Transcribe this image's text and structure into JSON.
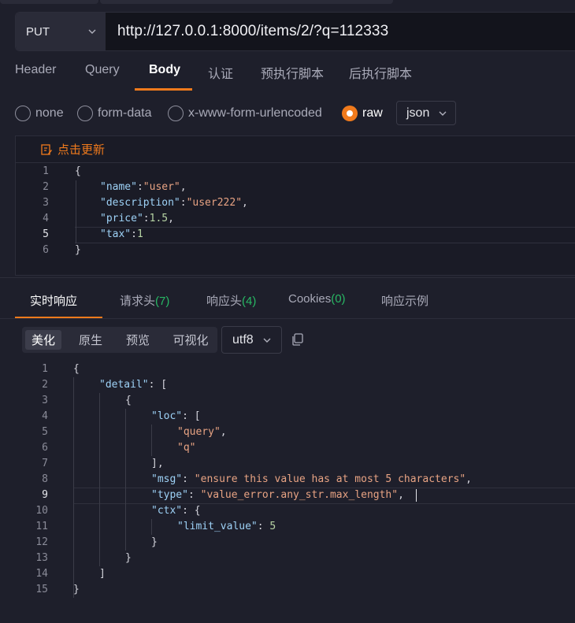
{
  "request": {
    "method": "PUT",
    "url": "http://127.0.0.1:8000/items/2/?q=112333",
    "tabs": [
      "Header",
      "Query",
      "Body",
      "认证",
      "预执行脚本",
      "后执行脚本"
    ],
    "active_tab": "Body",
    "body_types": [
      "none",
      "form-data",
      "x-www-form-urlencoded",
      "raw"
    ],
    "selected_body_type": "raw",
    "body_language": "json",
    "update_label": "点击更新"
  },
  "request_body_lines": [
    {
      "n": "1"
    },
    {
      "n": "2"
    },
    {
      "n": "3"
    },
    {
      "n": "4"
    },
    {
      "n": "5"
    },
    {
      "n": "6"
    }
  ],
  "request_body": {
    "l1": "{",
    "l2_key": "\"name\"",
    "l2_sep": ":",
    "l2_val": "\"user\"",
    "l2_end": ",",
    "l3_key": "\"description\"",
    "l3_sep": ":",
    "l3_val": "\"user222\"",
    "l3_end": ",",
    "l4_key": "\"price\"",
    "l4_sep": ":",
    "l4_val": "1.5",
    "l4_end": ",",
    "l5_key": "\"tax\"",
    "l5_sep": ":",
    "l5_val": "1",
    "l6": "}"
  },
  "response": {
    "tabs": [
      {
        "label": "实时响应",
        "count": ""
      },
      {
        "label": "请求头",
        "count": "(7)"
      },
      {
        "label": "响应头",
        "count": "(4)"
      },
      {
        "label": "Cookies",
        "count": "(0)"
      },
      {
        "label": "响应示例",
        "count": ""
      }
    ],
    "view_modes": [
      "美化",
      "原生",
      "预览",
      "可视化"
    ],
    "active_view": "美化",
    "encoding": "utf8"
  },
  "response_body": {
    "l1": "{",
    "l2_key": "\"detail\"",
    "l2_rest": ": [",
    "l3": "{",
    "l4_key": "\"loc\"",
    "l4_rest": ": [",
    "l5": "\"query\"",
    "l5_end": ",",
    "l6": "\"q\"",
    "l7": "],",
    "l8_key": "\"msg\"",
    "l8_sep": ": ",
    "l8_val": "\"ensure this value has at most 5 characters\"",
    "l8_end": ",",
    "l9_key": "\"type\"",
    "l9_sep": ": ",
    "l9_val": "\"value_error.any_str.max_length\"",
    "l9_end": ",",
    "l10_key": "\"ctx\"",
    "l10_rest": ": {",
    "l11_key": "\"limit_value\"",
    "l11_sep": ": ",
    "l11_val": "5",
    "l12": "}",
    "l13": "}",
    "l14": "]",
    "l15": "}"
  },
  "response_line_numbers": [
    "1",
    "2",
    "3",
    "4",
    "5",
    "6",
    "7",
    "8",
    "9",
    "10",
    "11",
    "12",
    "13",
    "14",
    "15"
  ],
  "colors": {
    "accent": "#f07a1c",
    "count_green": "#28b864",
    "json_key": "#9ed2f7",
    "json_string": "#e8a383",
    "json_number": "#b6d3a3"
  }
}
